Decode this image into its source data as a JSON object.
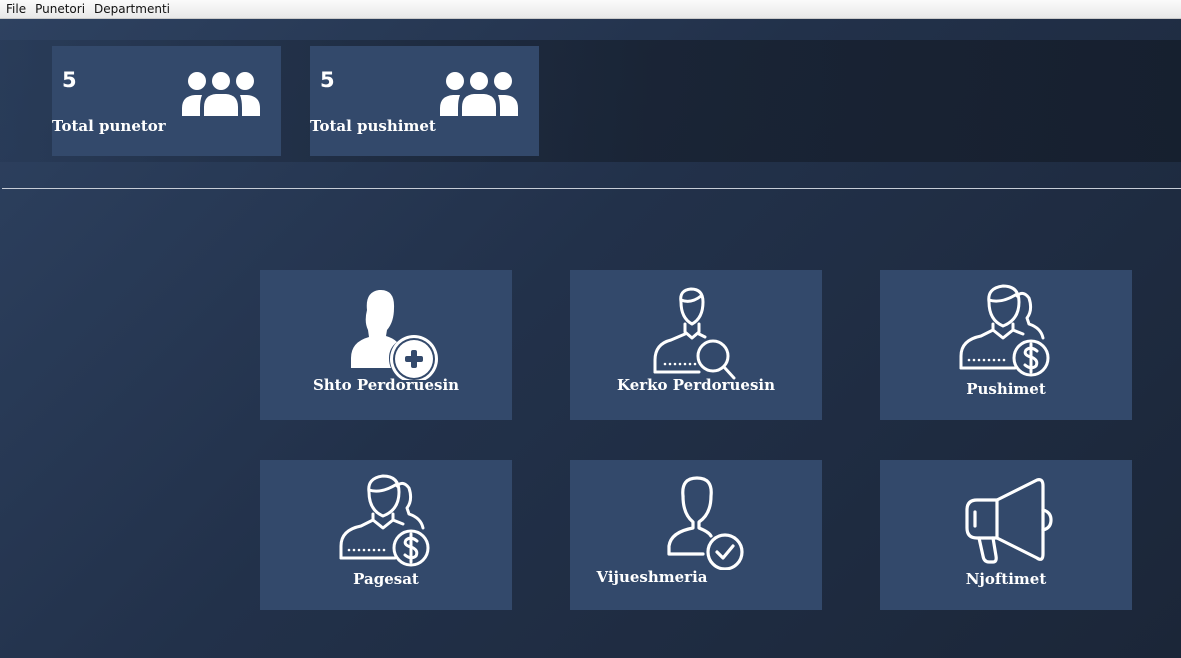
{
  "menu": [
    "File",
    "Punetori",
    "Departmenti"
  ],
  "stats": [
    {
      "count": "5",
      "label": "Total punetor",
      "icon": "users-group-icon"
    },
    {
      "count": "5",
      "label": "Total pushimet",
      "icon": "users-group-icon"
    }
  ],
  "tiles": [
    {
      "label": "Shto Perdoruesin",
      "icon": "add-user-icon"
    },
    {
      "label": "Kerko Perdoruesin",
      "icon": "search-user-icon"
    },
    {
      "label": "Pushimet",
      "icon": "user-dollar-icon"
    },
    {
      "label": "Pagesat",
      "icon": "user-dollar-icon"
    },
    {
      "label": "Vijueshmeria",
      "icon": "user-check-icon"
    },
    {
      "label": "Njoftimet",
      "icon": "megaphone-icon"
    }
  ],
  "colors": {
    "background": "#22314a",
    "card": "#33496b",
    "text": "#ffffff",
    "menubar": "#f0f0f0"
  }
}
